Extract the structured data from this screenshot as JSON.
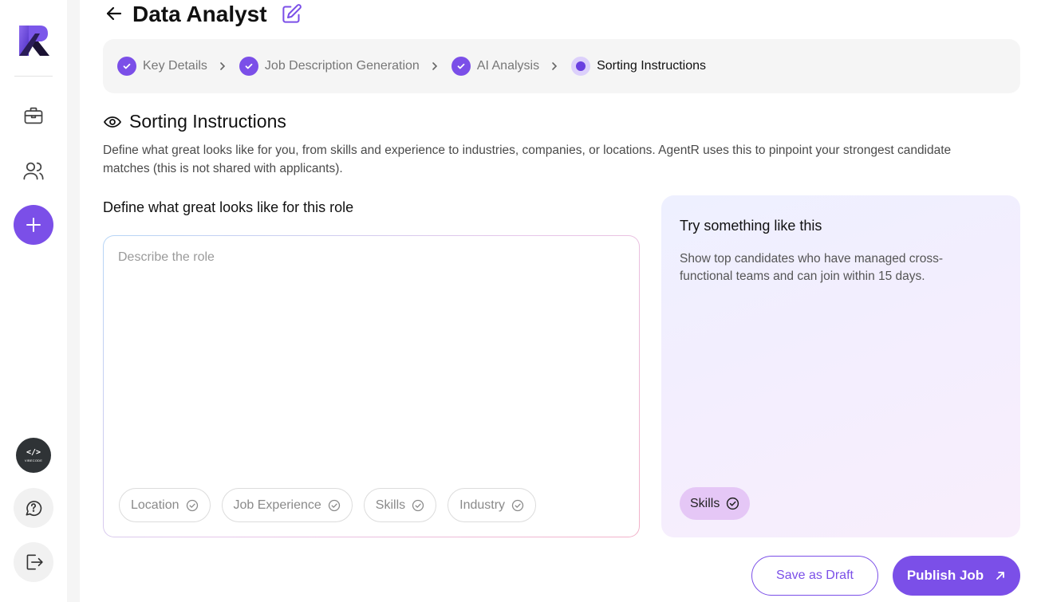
{
  "header": {
    "title": "Data Analyst"
  },
  "stepper": {
    "steps": [
      {
        "label": "Key Details",
        "status": "done"
      },
      {
        "label": "Job Description Generation",
        "status": "done"
      },
      {
        "label": "AI Analysis",
        "status": "done"
      },
      {
        "label": "Sorting Instructions",
        "status": "current"
      }
    ]
  },
  "section": {
    "title": "Sorting Instructions",
    "description": "Define what great looks like for you, from skills and experience to industries, companies, or locations. AgentR uses this to pinpoint your strongest candidate matches (this is not shared with applicants)."
  },
  "form": {
    "label": "Define what great looks like for this role",
    "placeholder": "Describe the role",
    "value": "",
    "chips": [
      "Location",
      "Job Experience",
      "Skills",
      "Industry"
    ]
  },
  "suggestion": {
    "title": "Try something like this",
    "text": "Show top candidates who have managed cross-functional teams and can join within 15 days.",
    "chip": "Skills"
  },
  "sidebar": {
    "badge_glyph": "</>",
    "badge_text": "VIBECODE",
    "icons": [
      "logo",
      "briefcase-icon",
      "users-icon",
      "plus-icon",
      "vibecode-badge",
      "help-chat-icon",
      "logout-icon"
    ]
  },
  "actions": {
    "draft_label": "Save as Draft",
    "publish_label": "Publish Job"
  },
  "colors": {
    "accent": "#7b4fe8",
    "stepper_bg": "#f5f5f5",
    "chip_active_bg": "#e5c7f6"
  }
}
